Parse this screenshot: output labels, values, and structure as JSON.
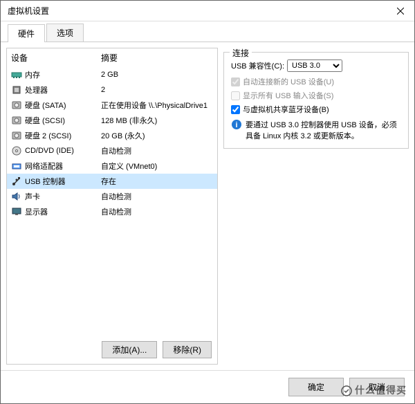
{
  "window": {
    "title": "虚拟机设置"
  },
  "tabs": {
    "hardware": "硬件",
    "options": "选项"
  },
  "listHeader": {
    "device": "设备",
    "summary": "摘要"
  },
  "devices": [
    {
      "name": "内存",
      "summary": "2 GB",
      "icon": "memory"
    },
    {
      "name": "处理器",
      "summary": "2",
      "icon": "cpu"
    },
    {
      "name": "硬盘 (SATA)",
      "summary": "正在使用设备 \\\\.\\PhysicalDrive1",
      "icon": "disk"
    },
    {
      "name": "硬盘 (SCSI)",
      "summary": "128 MB (非永久)",
      "icon": "disk"
    },
    {
      "name": "硬盘 2 (SCSI)",
      "summary": "20 GB (永久)",
      "icon": "disk"
    },
    {
      "name": "CD/DVD (IDE)",
      "summary": "自动检测",
      "icon": "cd"
    },
    {
      "name": "网络适配器",
      "summary": "自定义 (VMnet0)",
      "icon": "network"
    },
    {
      "name": "USB 控制器",
      "summary": "存在",
      "icon": "usb",
      "selected": true
    },
    {
      "name": "声卡",
      "summary": "自动检测",
      "icon": "sound"
    },
    {
      "name": "显示器",
      "summary": "自动检测",
      "icon": "display"
    }
  ],
  "panelButtons": {
    "add": "添加(A)...",
    "remove": "移除(R)"
  },
  "connection": {
    "title": "连接",
    "compatLabel": "USB 兼容性(C):",
    "compatValue": "USB 3.0",
    "autoConnect": "自动连接新的 USB 设备(U)",
    "showAll": "显示所有 USB 输入设备(S)",
    "shareBluetooth": "与虚拟机共享蓝牙设备(B)",
    "info": "要通过 USB 3.0 控制器使用 USB 设备，必须具备 Linux 内核 3.2 或更新版本。"
  },
  "dialogButtons": {
    "ok": "确定",
    "cancel": "取消"
  },
  "watermark": "什么值得买"
}
